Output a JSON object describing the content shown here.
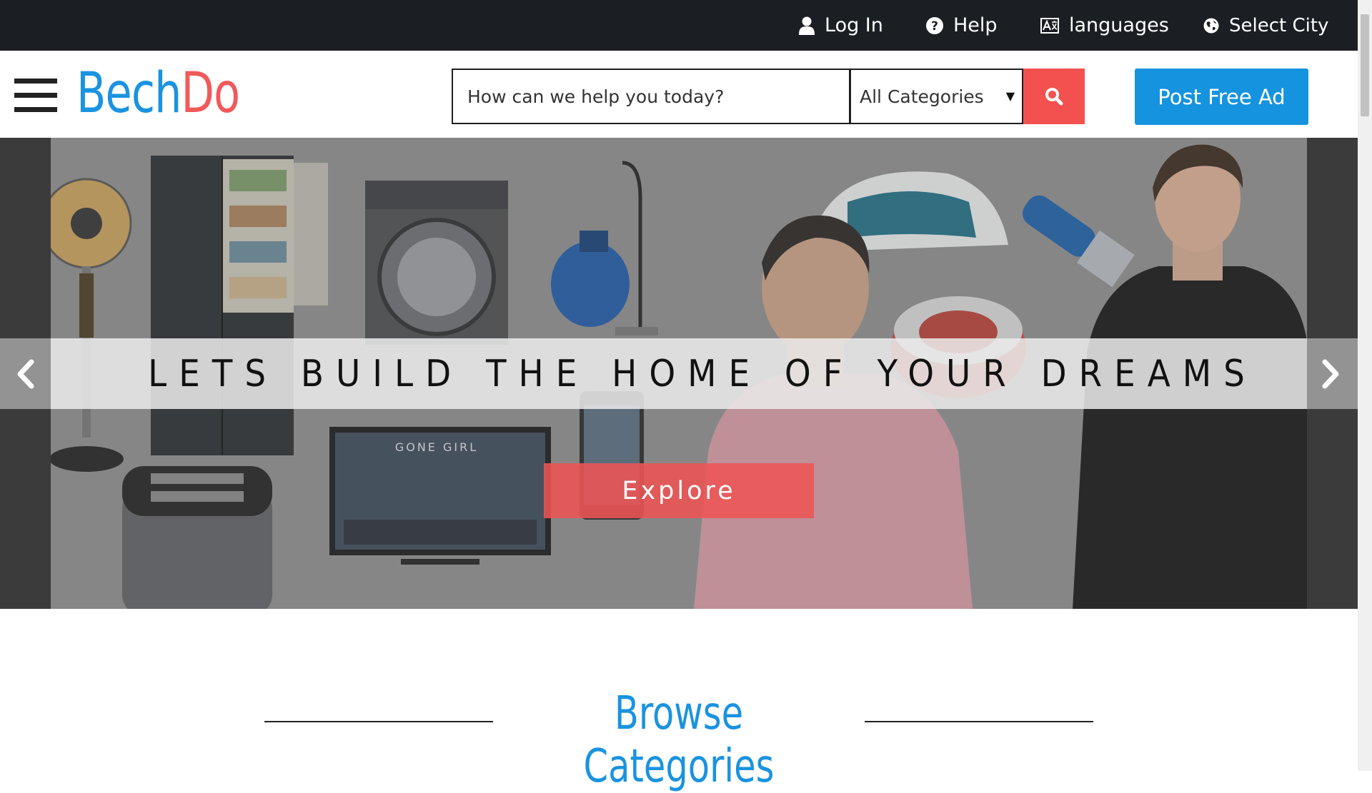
{
  "topbar": {
    "login_label": "Log In",
    "help_label": "Help",
    "languages_label": "languages",
    "city_label": "Select City"
  },
  "header": {
    "logo_part1": "Bech",
    "logo_part2": "Do",
    "search_placeholder": "How can we help you today?",
    "category_selected": "All Categories",
    "post_ad_label": "Post Free Ad"
  },
  "hero": {
    "banner_text": "LETS BUILD THE HOME OF YOUR DREAMS",
    "explore_label": "Explore",
    "tv_title": "GONE GIRL"
  },
  "browse": {
    "title": "Browse Categories"
  },
  "colors": {
    "topbar_bg": "#1b1f23",
    "brand_blue": "#1a93e0",
    "brand_red": "#f05a5a",
    "search_button": "#f2514f",
    "post_ad_button": "#1693de"
  },
  "icons": [
    "user-icon",
    "help-circle-icon",
    "languages-icon",
    "globe-icon",
    "hamburger-icon",
    "search-icon",
    "chevron-left-icon",
    "chevron-right-icon"
  ]
}
